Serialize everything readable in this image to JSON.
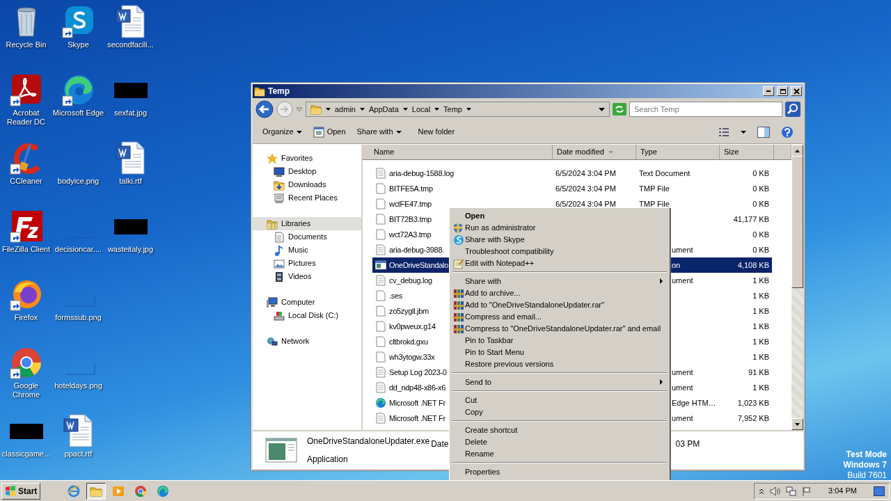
{
  "desktop_icons": [
    {
      "label": "Recycle Bin",
      "kind": "recycle-bin",
      "shortcut": false
    },
    {
      "label": "Acrobat Reader DC",
      "kind": "acrobat",
      "shortcut": true
    },
    {
      "label": "CCleaner",
      "kind": "ccleaner",
      "shortcut": true
    },
    {
      "label": "FileZilla Client",
      "kind": "filezilla",
      "shortcut": true
    },
    {
      "label": "Firefox",
      "kind": "firefox",
      "shortcut": true
    },
    {
      "label": "Google Chrome",
      "kind": "chrome",
      "shortcut": true
    },
    {
      "label": "classicgame...",
      "kind": "dark-thumb",
      "shortcut": false
    },
    {
      "label": "Skype",
      "kind": "skype",
      "shortcut": true
    },
    {
      "label": "Microsoft Edge",
      "kind": "edge",
      "shortcut": true
    },
    {
      "label": "bodyice.png",
      "kind": "blank-thumb",
      "shortcut": false
    },
    {
      "label": "decisioncar....",
      "kind": "blank-thumb",
      "shortcut": false
    },
    {
      "label": "formssub.png",
      "kind": "blank-thumb",
      "shortcut": false
    },
    {
      "label": "hoteldays.png",
      "kind": "blank-thumb",
      "shortcut": false
    },
    {
      "label": "ppact.rtf",
      "kind": "document",
      "shortcut": false
    },
    {
      "label": "secondfacili...",
      "kind": "document",
      "shortcut": false
    },
    {
      "label": "sexfat.jpg",
      "kind": "dark-thumb",
      "shortcut": false
    },
    {
      "label": "talki.rtf",
      "kind": "document",
      "shortcut": false
    },
    {
      "label": "wasteitaly.jpg",
      "kind": "dark-thumb",
      "shortcut": false
    }
  ],
  "window": {
    "title": "Temp",
    "breadcrumb": [
      "admin",
      "AppData",
      "Local",
      "Temp"
    ],
    "search": {
      "placeholder": "Search Temp"
    },
    "toolbar": [
      {
        "label": "Organize",
        "kind": "menu"
      },
      {
        "label": "Open",
        "kind": "open"
      },
      {
        "label": "Share with",
        "kind": "menu"
      },
      {
        "label": "New folder",
        "kind": "plain"
      }
    ],
    "nav": [
      {
        "label": "Favorites",
        "kind": "star",
        "selected": false,
        "children": [
          {
            "label": "Desktop",
            "kind": "desktop",
            "selected": false
          },
          {
            "label": "Downloads",
            "kind": "downloads",
            "selected": false
          },
          {
            "label": "Recent Places",
            "kind": "recent",
            "selected": false
          }
        ]
      },
      {
        "label": "Libraries",
        "kind": "library",
        "selected": true,
        "children": [
          {
            "label": "Documents",
            "kind": "documents",
            "selected": false
          },
          {
            "label": "Music",
            "kind": "music",
            "selected": false
          },
          {
            "label": "Pictures",
            "kind": "pictures",
            "selected": false
          },
          {
            "label": "Videos",
            "kind": "videos",
            "selected": false
          }
        ]
      },
      {
        "label": "Computer",
        "kind": "computer",
        "selected": false,
        "children": [
          {
            "label": "Local Disk (C:)",
            "kind": "disk",
            "selected": false
          }
        ]
      },
      {
        "label": "Network",
        "kind": "network",
        "selected": false
      }
    ],
    "table": {
      "columns": [
        {
          "label": "Name",
          "sorted": false
        },
        {
          "label": "Date modified",
          "sorted": true
        },
        {
          "label": "Type",
          "sorted": false
        },
        {
          "label": "Size",
          "sorted": false
        }
      ],
      "rows": [
        {
          "name": "aria-debug-1588.log",
          "date": "6/5/2024 3:04 PM",
          "type": "Text Document",
          "size": "0 KB",
          "kind": "text",
          "selected": false
        },
        {
          "name": "BITFE5A.tmp",
          "date": "6/5/2024 3:04 PM",
          "type": "TMP File",
          "size": "0 KB",
          "kind": "blank",
          "selected": false
        },
        {
          "name": "wctFE47.tmp",
          "date": "6/5/2024 3:04 PM",
          "type": "TMP File",
          "size": "0 KB",
          "kind": "blank",
          "selected": false
        },
        {
          "name": "BIT72B3.tmp",
          "size": "41,177 KB",
          "kind": "blank",
          "selected": false
        },
        {
          "name": "wct72A3.tmp",
          "size": "0 KB",
          "kind": "blank",
          "selected": false
        },
        {
          "name": "aria-debug-3988.",
          "type": "ument",
          "size": "0 KB",
          "kind": "text",
          "selected": false
        },
        {
          "name": "OneDriveStandalo",
          "type": "on",
          "size": "4,108 KB",
          "kind": "application",
          "selected": true
        },
        {
          "name": "cv_debug.log",
          "type": "ument",
          "size": "1 KB",
          "kind": "text",
          "selected": false
        },
        {
          "name": ".ses",
          "size": "1 KB",
          "kind": "blank",
          "selected": false
        },
        {
          "name": "zo5zygll.jbm",
          "size": "1 KB",
          "kind": "blank",
          "selected": false
        },
        {
          "name": "kv0pweux.g14",
          "size": "1 KB",
          "kind": "blank",
          "selected": false
        },
        {
          "name": "cltbrokd.gxu",
          "size": "1 KB",
          "kind": "blank",
          "selected": false
        },
        {
          "name": "wh3ytogw.33x",
          "size": "1 KB",
          "kind": "blank",
          "selected": false
        },
        {
          "name": "Setup Log 2023-0",
          "type": "ument",
          "size": "91 KB",
          "kind": "text",
          "selected": false
        },
        {
          "name": "dd_ndp48-x86-x6",
          "type": "ument",
          "size": "1 KB",
          "kind": "text",
          "selected": false
        },
        {
          "name": "Microsoft .NET Fr",
          "type": "Edge HTM…",
          "size": "1,023 KB",
          "kind": "edge",
          "selected": false
        },
        {
          "name": "Microsoft .NET Fr",
          "type": "ument",
          "size": "7,952 KB",
          "kind": "text",
          "selected": false
        }
      ]
    },
    "details": {
      "name": "OneDriveStandaloneUpdater.exe",
      "field": "Date",
      "type": "Application",
      "value": "03 PM"
    }
  },
  "context_menu": [
    {
      "label": "Open",
      "kind": "plain",
      "default": true,
      "submenu": false
    },
    {
      "label": "Run as administrator",
      "kind": "shield",
      "default": false,
      "submenu": false
    },
    {
      "label": "Share with Skype",
      "kind": "skype",
      "default": false,
      "submenu": false
    },
    {
      "label": "Troubleshoot compatibility",
      "kind": "plain",
      "default": false,
      "submenu": false
    },
    {
      "label": "Edit with Notepad++",
      "kind": "notepad",
      "default": false,
      "submenu": false
    },
    {
      "kind": "separator"
    },
    {
      "label": "Share with",
      "kind": "plain",
      "default": false,
      "submenu": true
    },
    {
      "label": "Add to archive...",
      "kind": "archive",
      "default": false,
      "submenu": false
    },
    {
      "label": "Add to \"OneDriveStandaloneUpdater.rar\"",
      "kind": "archive",
      "default": false,
      "submenu": false
    },
    {
      "label": "Compress and email...",
      "kind": "archive",
      "default": false,
      "submenu": false
    },
    {
      "label": "Compress to \"OneDriveStandaloneUpdater.rar\" and email",
      "kind": "archive",
      "default": false,
      "submenu": false
    },
    {
      "label": "Pin to Taskbar",
      "kind": "plain",
      "default": false,
      "submenu": false
    },
    {
      "label": "Pin to Start Menu",
      "kind": "plain",
      "default": false,
      "submenu": false
    },
    {
      "label": "Restore previous versions",
      "kind": "plain",
      "default": false,
      "submenu": false
    },
    {
      "kind": "separator"
    },
    {
      "label": "Send to",
      "kind": "plain",
      "default": false,
      "submenu": true
    },
    {
      "kind": "separator"
    },
    {
      "label": "Cut",
      "kind": "plain",
      "default": false,
      "submenu": false
    },
    {
      "label": "Copy",
      "kind": "plain",
      "default": false,
      "submenu": false
    },
    {
      "kind": "separator"
    },
    {
      "label": "Create shortcut",
      "kind": "plain",
      "default": false,
      "submenu": false
    },
    {
      "label": "Delete",
      "kind": "plain",
      "default": false,
      "submenu": false
    },
    {
      "label": "Rename",
      "kind": "plain",
      "default": false,
      "submenu": false
    },
    {
      "kind": "separator"
    },
    {
      "label": "Properties",
      "kind": "plain",
      "default": false,
      "submenu": false
    }
  ],
  "os_notice": [
    "Test Mode",
    "Windows 7",
    "Build 7601"
  ],
  "taskbar": {
    "start": "Start",
    "apps": [
      {
        "kind": "ie",
        "active": false
      },
      {
        "kind": "explorer",
        "active": true
      },
      {
        "kind": "media",
        "active": false
      },
      {
        "kind": "chrome",
        "active": false
      },
      {
        "kind": "edge",
        "active": false
      }
    ],
    "clock": "3:04 PM"
  }
}
